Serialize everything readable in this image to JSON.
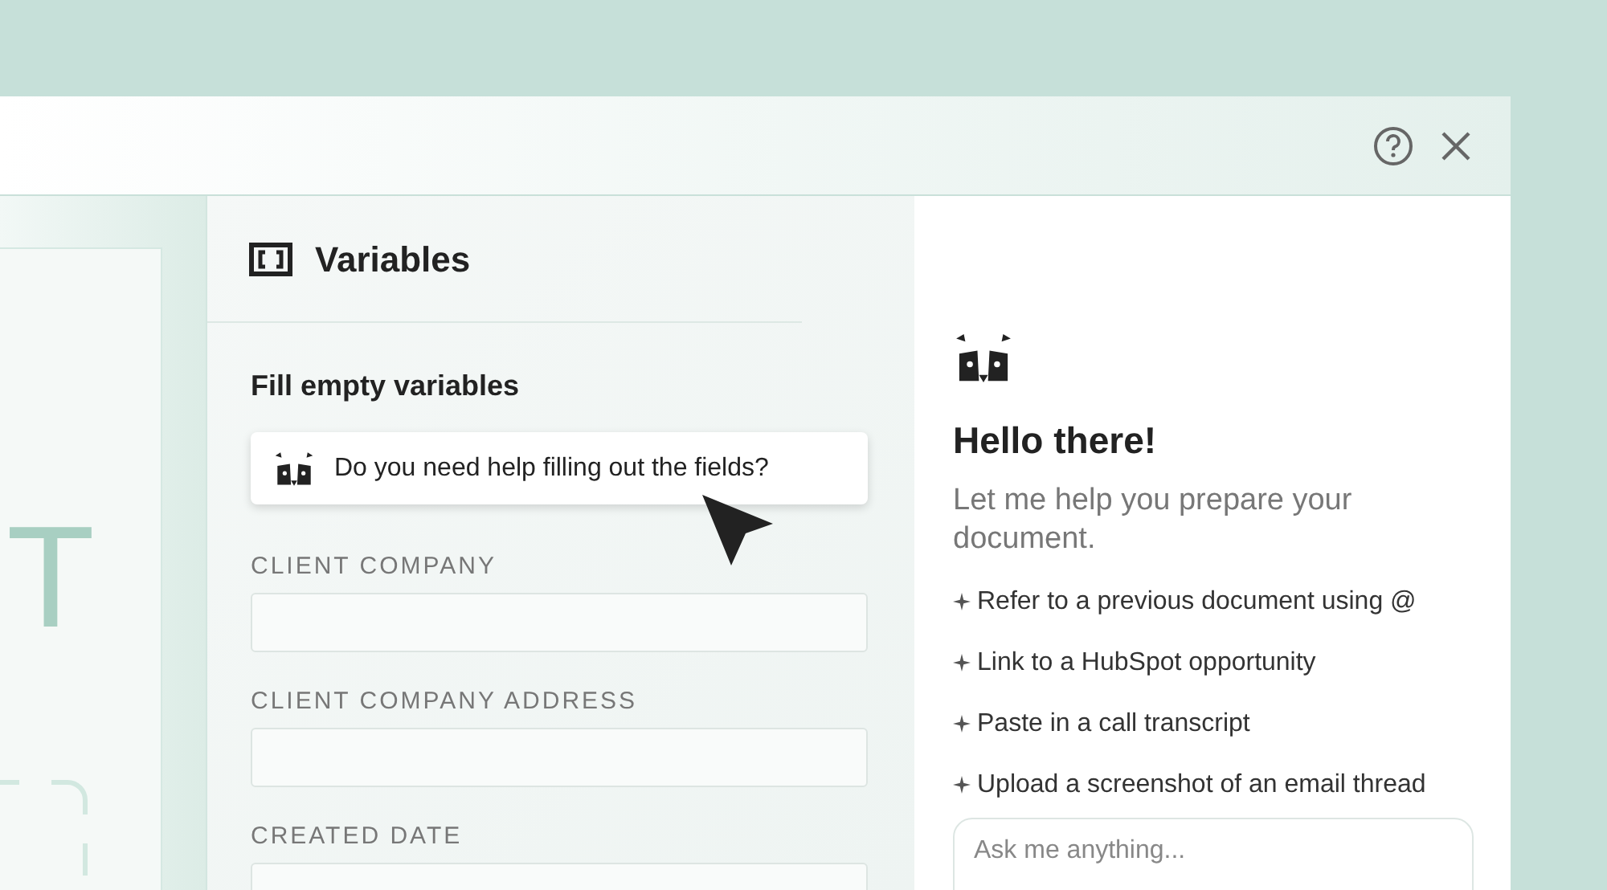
{
  "window": {
    "controls": [
      {
        "kind": "help"
      },
      {
        "kind": "close"
      }
    ]
  },
  "document_preview": {
    "letter": "T"
  },
  "variables_panel": {
    "title": "Variables",
    "section_title": "Fill empty variables",
    "assistant_prompt": "Do you need help filling out the fields?",
    "fields": [
      {
        "label": "CLIENT COMPANY"
      },
      {
        "label": "CLIENT COMPANY ADDRESS"
      },
      {
        "label": "CREATED DATE"
      }
    ]
  },
  "assistant_panel": {
    "greeting": "Hello there!",
    "subtitle": "Let me help you prepare your document.",
    "suggestions": [
      "Refer to a previous document using @",
      "Link to a HubSpot opportunity",
      "Paste in a call transcript",
      "Upload a screenshot of an email thread"
    ],
    "chat_input": {
      "placeholder": "Ask me anything..."
    }
  }
}
